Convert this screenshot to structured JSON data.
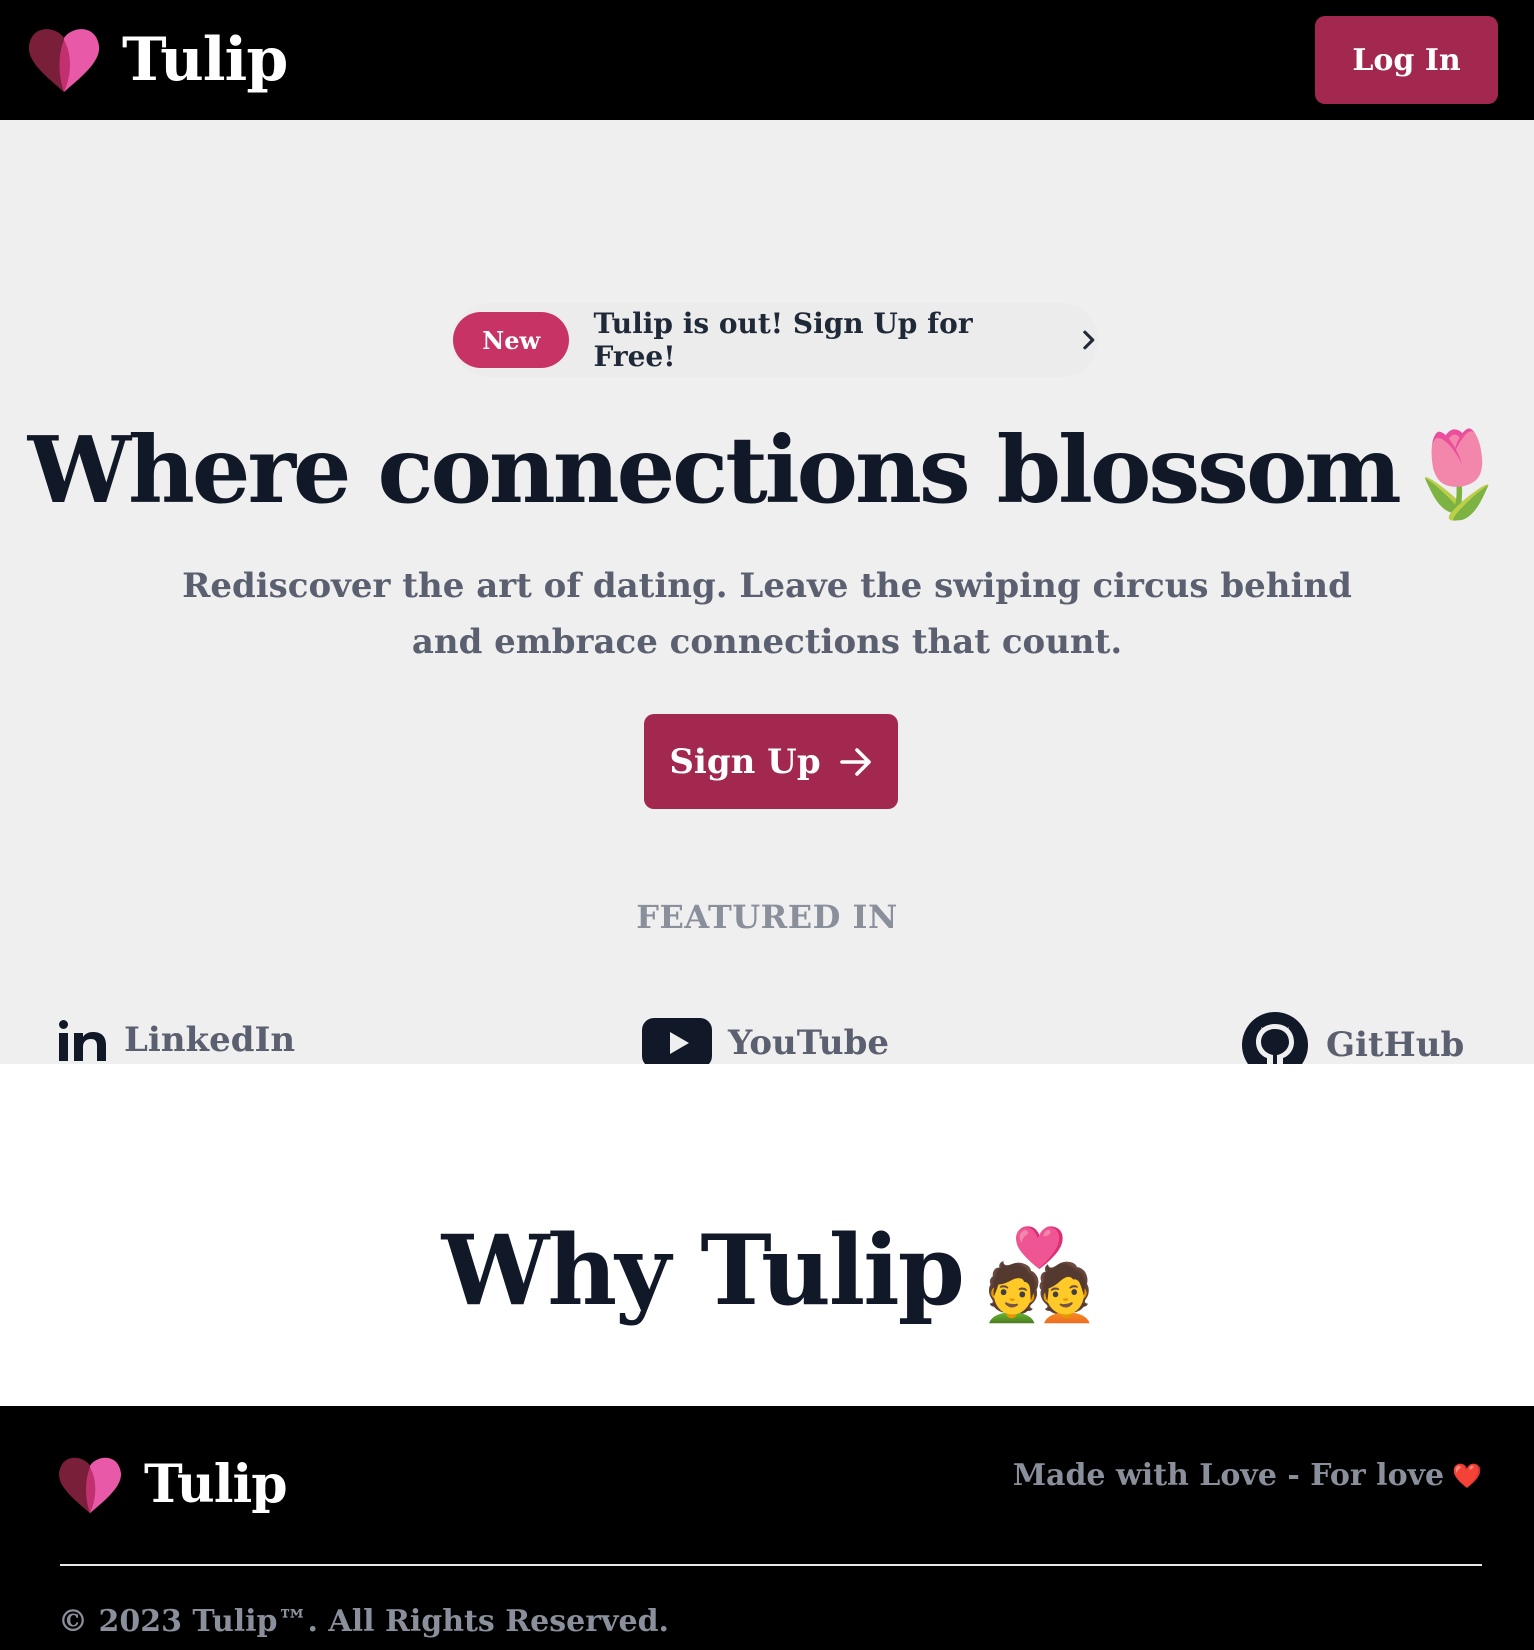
{
  "header": {
    "brand": "Tulip",
    "login_label": "Log In"
  },
  "hero": {
    "badge": "New",
    "announcement": "Tulip is out! Sign Up for Free!",
    "title": "Where connections blossom",
    "title_emoji": "🌷",
    "subtitle": "Rediscover the art of dating. Leave the swiping circus behind and embrace connections that count.",
    "signup_label": "Sign Up",
    "featured_heading": "FEATURED IN",
    "featured": [
      {
        "name": "LinkedIn",
        "icon": "linkedin-icon"
      },
      {
        "name": "YouTube",
        "icon": "youtube-icon"
      },
      {
        "name": "GitHub",
        "icon": "github-icon"
      }
    ]
  },
  "why": {
    "title": "Why Tulip",
    "emoji": "💑"
  },
  "footer": {
    "brand": "Tulip",
    "tagline": "Made with Love - For love",
    "tagline_emoji": "❤️",
    "copyright": "© 2023 Tulip™. All Rights Reserved."
  },
  "colors": {
    "accent": "#a3284f",
    "badge": "#c73365",
    "hero_bg": "#efefef",
    "header_bg": "#000000"
  }
}
